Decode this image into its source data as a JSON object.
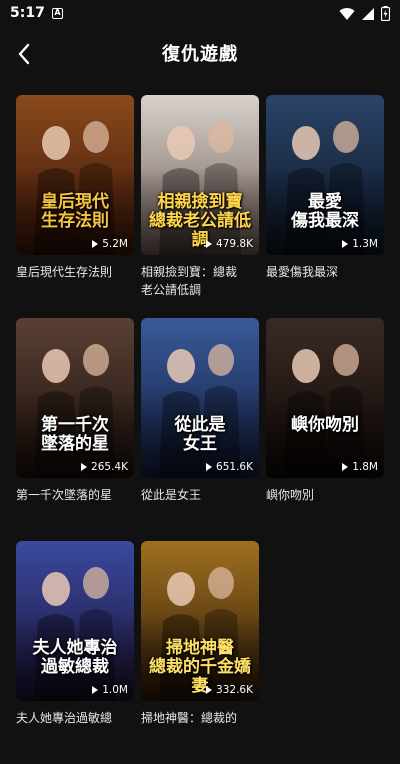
{
  "status_bar": {
    "time": "5:17",
    "notif_glyph": "A",
    "icons": [
      "wifi-icon",
      "signal-icon",
      "battery-charging-icon"
    ]
  },
  "header": {
    "title": "復仇遊戲",
    "back_icon": "chevron-left-icon"
  },
  "colors": {
    "background": "#111111",
    "text": "#ffffff",
    "subtext": "#e8e8e8"
  },
  "dramas": [
    {
      "title": "皇后現代生存法則",
      "cover_text": "皇后現代\n生存法則",
      "views": "5.2M",
      "text_color": "#f5c542",
      "bg": [
        "#8a4a1c",
        "#3a1408"
      ]
    },
    {
      "title": "相親撿到寶：總裁\n老公請低調",
      "cover_text": "相親撿到寶\n總裁老公請低調",
      "views": "479.8K",
      "text_color": "#ffd54a",
      "bg": [
        "#d8d2cc",
        "#6c5a52"
      ]
    },
    {
      "title": "最愛傷我最深",
      "cover_text": "最愛\n傷我最深",
      "views": "1.3M",
      "text_color": "#ffffff",
      "bg": [
        "#2a4468",
        "#0c1424"
      ]
    },
    {
      "title": "第一千次墜落的星",
      "cover_text": "第一千次\n墜落的星",
      "views": "265.4K",
      "text_color": "#ffffff",
      "bg": [
        "#5a4034",
        "#1a0f0a"
      ]
    },
    {
      "title": "從此是女王",
      "cover_text": "從此是\n女王",
      "views": "651.6K",
      "text_color": "#ffffff",
      "bg": [
        "#3a5a9a",
        "#101c3a"
      ]
    },
    {
      "title": "嶼你吻別",
      "cover_text": "嶼你吻別",
      "views": "1.8M",
      "text_color": "#ffffff",
      "bg": [
        "#3a2a24",
        "#0e0806"
      ]
    },
    {
      "title": "夫人她專治過敏總",
      "cover_text": "夫人她專治\n過敏總裁",
      "views": "1.0M",
      "text_color": "#ffffff",
      "bg": [
        "#3a4aa0",
        "#1a1030"
      ]
    },
    {
      "title": "掃地神醫：總裁的",
      "cover_text": "掃地神醫\n總裁的千金嬌妻",
      "views": "332.6K",
      "text_color": "#ffe066",
      "bg": [
        "#a07020",
        "#2a1808"
      ]
    }
  ]
}
